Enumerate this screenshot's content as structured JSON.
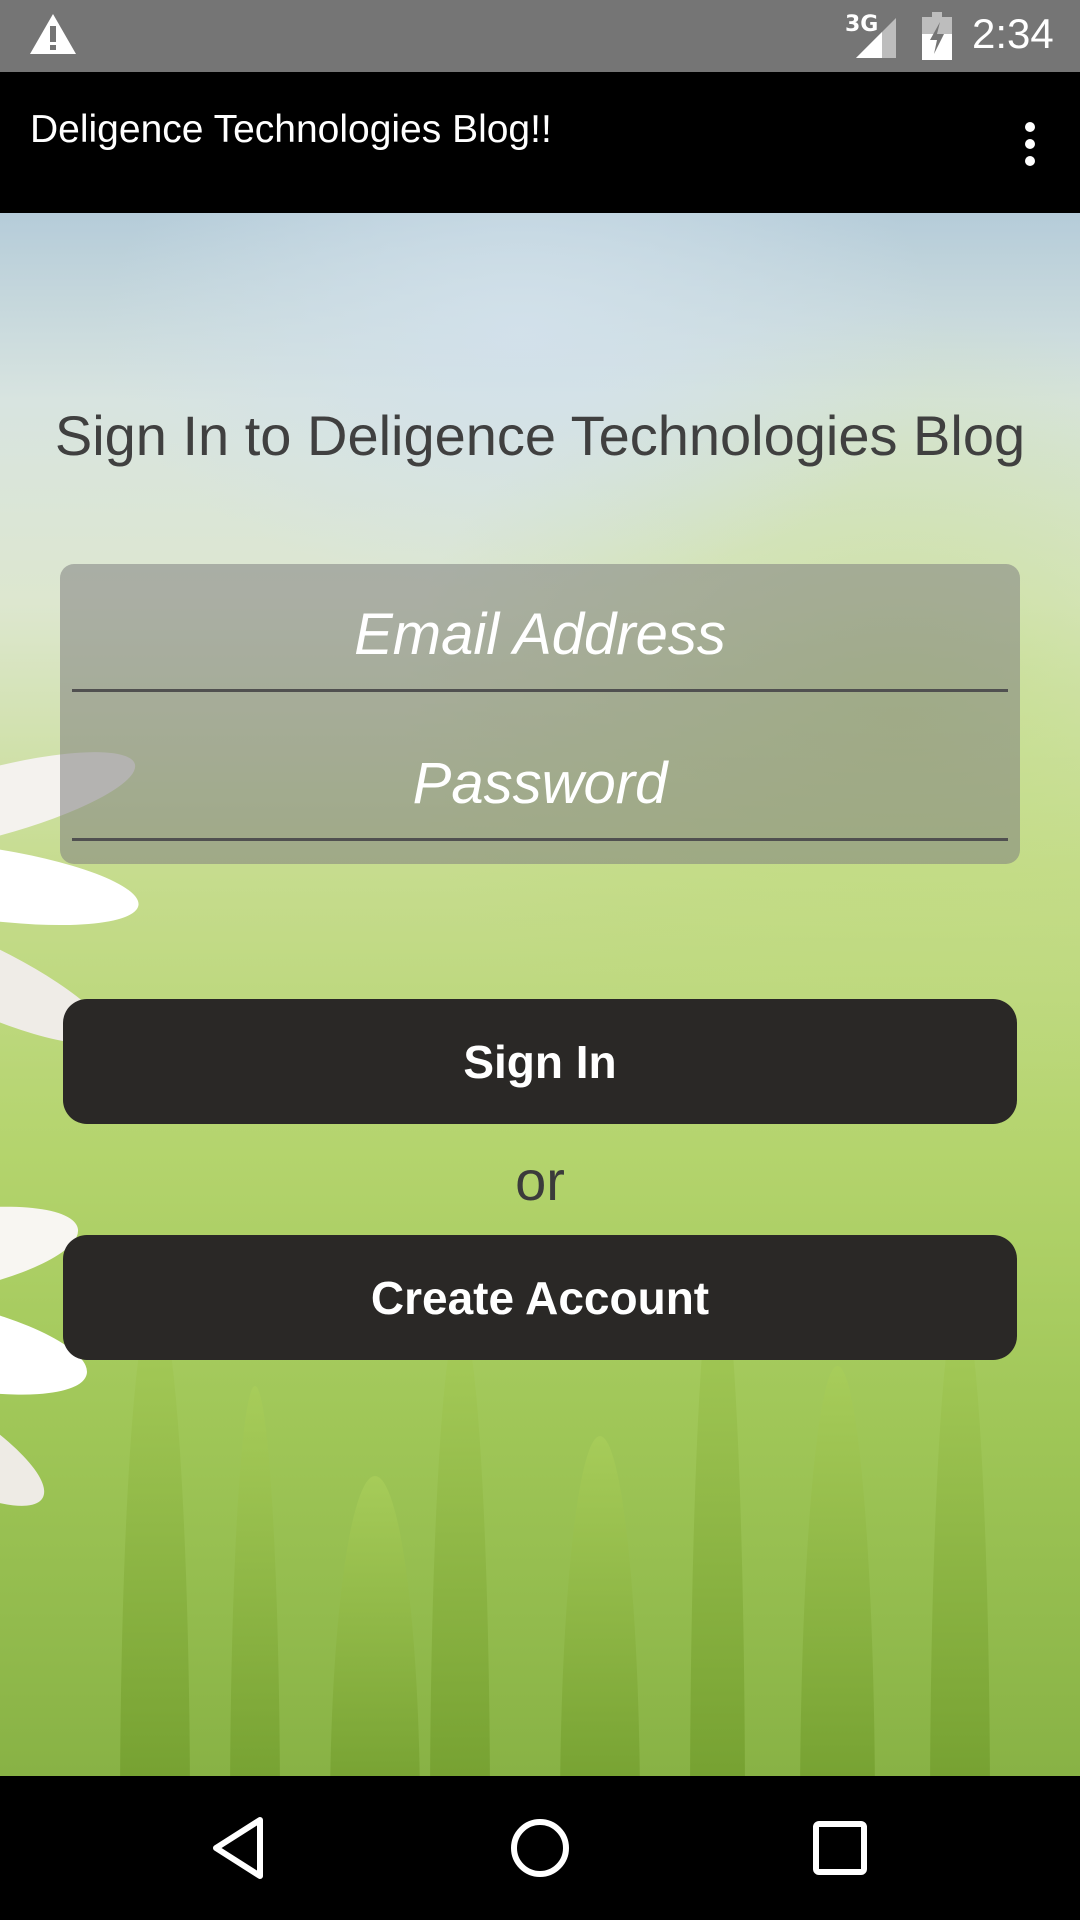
{
  "status_bar": {
    "network_type": "3G",
    "time": "2:34",
    "icons": [
      "warning-icon",
      "signal-icon",
      "battery-charging-icon"
    ]
  },
  "app_bar": {
    "title": "Deligence Technologies Blog!!",
    "menu_icon": "overflow-menu-icon"
  },
  "login": {
    "heading": "Sign In to Deligence Technologies Blog",
    "email_placeholder": "Email Address",
    "password_placeholder": "Password",
    "sign_in_label": "Sign In",
    "or_label": "or",
    "create_account_label": "Create Account"
  },
  "nav_bar": {
    "icons": [
      "back-icon",
      "home-icon",
      "recents-icon"
    ]
  },
  "colors": {
    "status_bar": "#757575",
    "app_bar": "#000000",
    "button": "#2a2826",
    "button_text": "#ffffff",
    "heading_text": "#404040"
  }
}
